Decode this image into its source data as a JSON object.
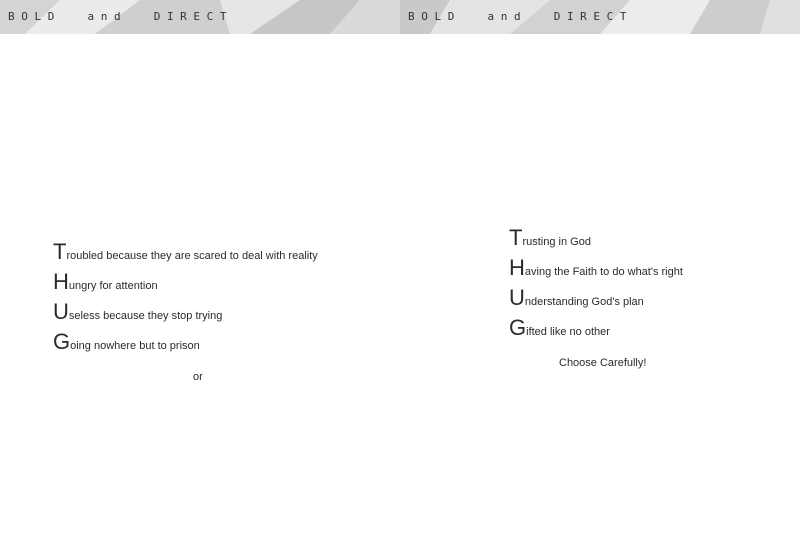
{
  "banner": {
    "left_text": "B O L D     a n d     D I R E C T",
    "right_text": "B O L D     a n d     D I R E C T",
    "bg_color": "#e2e2e2",
    "shade_colors": [
      "#d0d0d0",
      "#c2c2c2",
      "#ececec",
      "#d8d8d8"
    ]
  },
  "left_acrostic": {
    "lines": [
      {
        "initial": "T",
        "rest": "roubled because they are scared to deal with reality"
      },
      {
        "initial": "H",
        "rest": "ungry for attention"
      },
      {
        "initial": "U",
        "rest": "seless because they stop trying"
      },
      {
        "initial": "G",
        "rest": "oing nowhere but to prison"
      }
    ],
    "footer": "or"
  },
  "right_acrostic": {
    "lines": [
      {
        "initial": "T",
        "rest": "rusting in God"
      },
      {
        "initial": "H",
        "rest": "aving the Faith to do what's right"
      },
      {
        "initial": "U",
        "rest": "nderstanding  God's plan"
      },
      {
        "initial": "G",
        "rest": "ifted like no other"
      }
    ],
    "footer": "Choose Carefully!"
  }
}
